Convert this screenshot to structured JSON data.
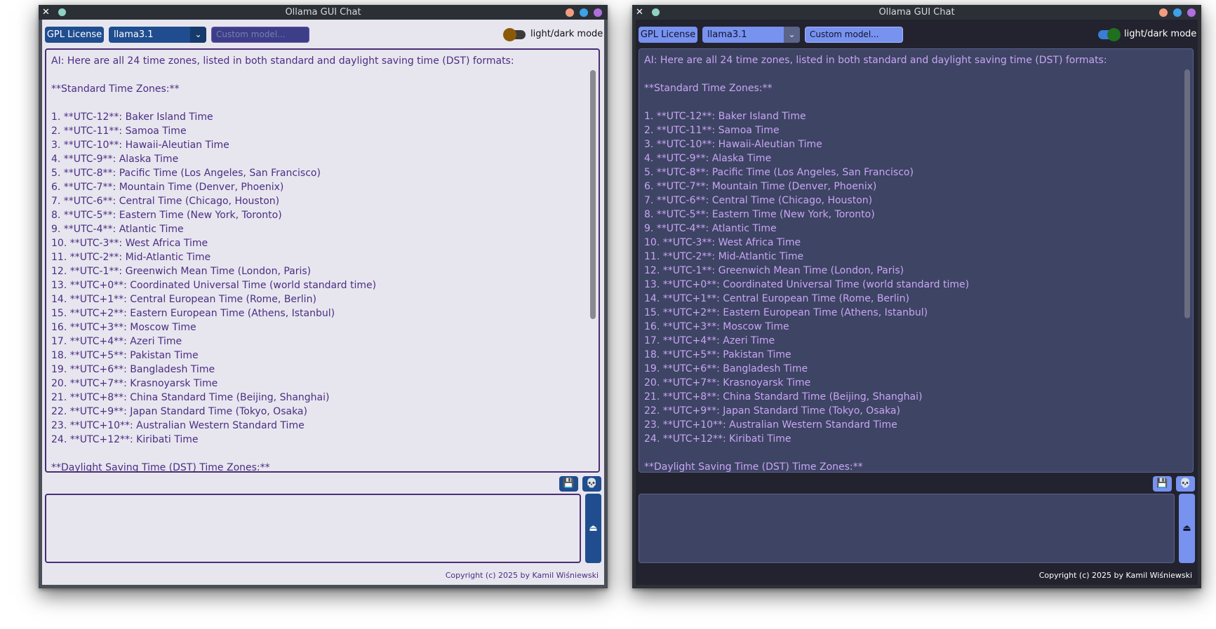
{
  "window_title": "Ollama GUI Chat",
  "toolbar": {
    "license_label": "GPL License",
    "model_selected": "llama3.1",
    "custom_model_placeholder": "Custom model...",
    "theme_toggle_label": "light/dark mode"
  },
  "chat": {
    "text": "AI: Here are all 24 time zones, listed in both standard and daylight saving time (DST) formats:\n\n**Standard Time Zones:**\n\n1. **UTC-12**: Baker Island Time\n2. **UTC-11**: Samoa Time\n3. **UTC-10**: Hawaii-Aleutian Time\n4. **UTC-9**: Alaska Time\n5. **UTC-8**: Pacific Time (Los Angeles, San Francisco)\n6. **UTC-7**: Mountain Time (Denver, Phoenix)\n7. **UTC-6**: Central Time (Chicago, Houston)\n8. **UTC-5**: Eastern Time (New York, Toronto)\n9. **UTC-4**: Atlantic Time\n10. **UTC-3**: West Africa Time\n11. **UTC-2**: Mid-Atlantic Time\n12. **UTC-1**: Greenwich Mean Time (London, Paris)\n13. **UTC+0**: Coordinated Universal Time (world standard time)\n14. **UTC+1**: Central European Time (Rome, Berlin)\n15. **UTC+2**: Eastern European Time (Athens, Istanbul)\n16. **UTC+3**: Moscow Time\n17. **UTC+4**: Azeri Time\n18. **UTC+5**: Pakistan Time\n19. **UTC+6**: Bangladesh Time\n20. **UTC+7**: Krasnoyarsk Time\n21. **UTC+8**: China Standard Time (Beijing, Shanghai)\n22. **UTC+9**: Japan Standard Time (Tokyo, Osaka)\n23. **UTC+10**: Australian Western Standard Time\n24. **UTC+12**: Kiribati Time\n\n**Daylight Saving Time (DST) Time Zones:**"
  },
  "icons": {
    "close": "✕",
    "save": "💾",
    "clear": "💀",
    "send": "⏏",
    "chevron": "⌄"
  },
  "message_input": {
    "value": ""
  },
  "footer": {
    "copyright": "Copyright (c) 2025 by Kamil Wiśniewski"
  },
  "colors": {
    "light_accent": "#1f4d8f",
    "light_text": "#4b2e82",
    "dark_accent": "#7892f0",
    "dark_text": "#c7a6f5",
    "dark_panel": "#3e4463"
  }
}
